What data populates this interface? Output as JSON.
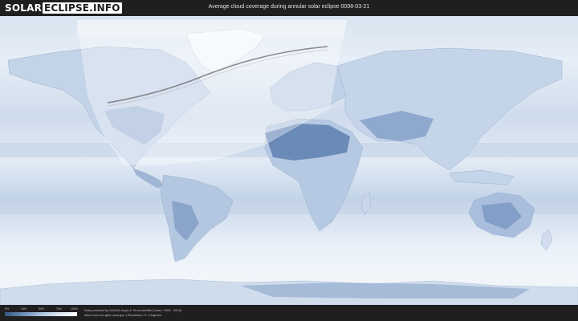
{
  "header": {
    "logo_part1": "SOLAR",
    "logo_part2": "ECLIPSE.INFO",
    "title": "Average cloud coverage during annular solar eclipse 0098-03-21"
  },
  "legend": {
    "labels": [
      "0%",
      "25%",
      "50%",
      "75%",
      "100%"
    ],
    "colors": [
      "#35557f",
      "#6d8db5",
      "#a9c1dc",
      "#dce7f3",
      "#ffffff"
    ]
  },
  "footer": {
    "credit_line1": "Data provided by NASA's Aqua & Terra satellite (Years: 2000 - 2019)",
    "credit_line2": "https://neo.sci.gsfc.nasa.gov | Resolution: 0.1 degrees"
  },
  "colors": {
    "background": "#1c1c1c",
    "ocean_cloud": "#dde7f2",
    "land_clear": "#6e8fbf",
    "eclipse_overlay": "#ffffff",
    "central_line": "#6f6f6f"
  }
}
